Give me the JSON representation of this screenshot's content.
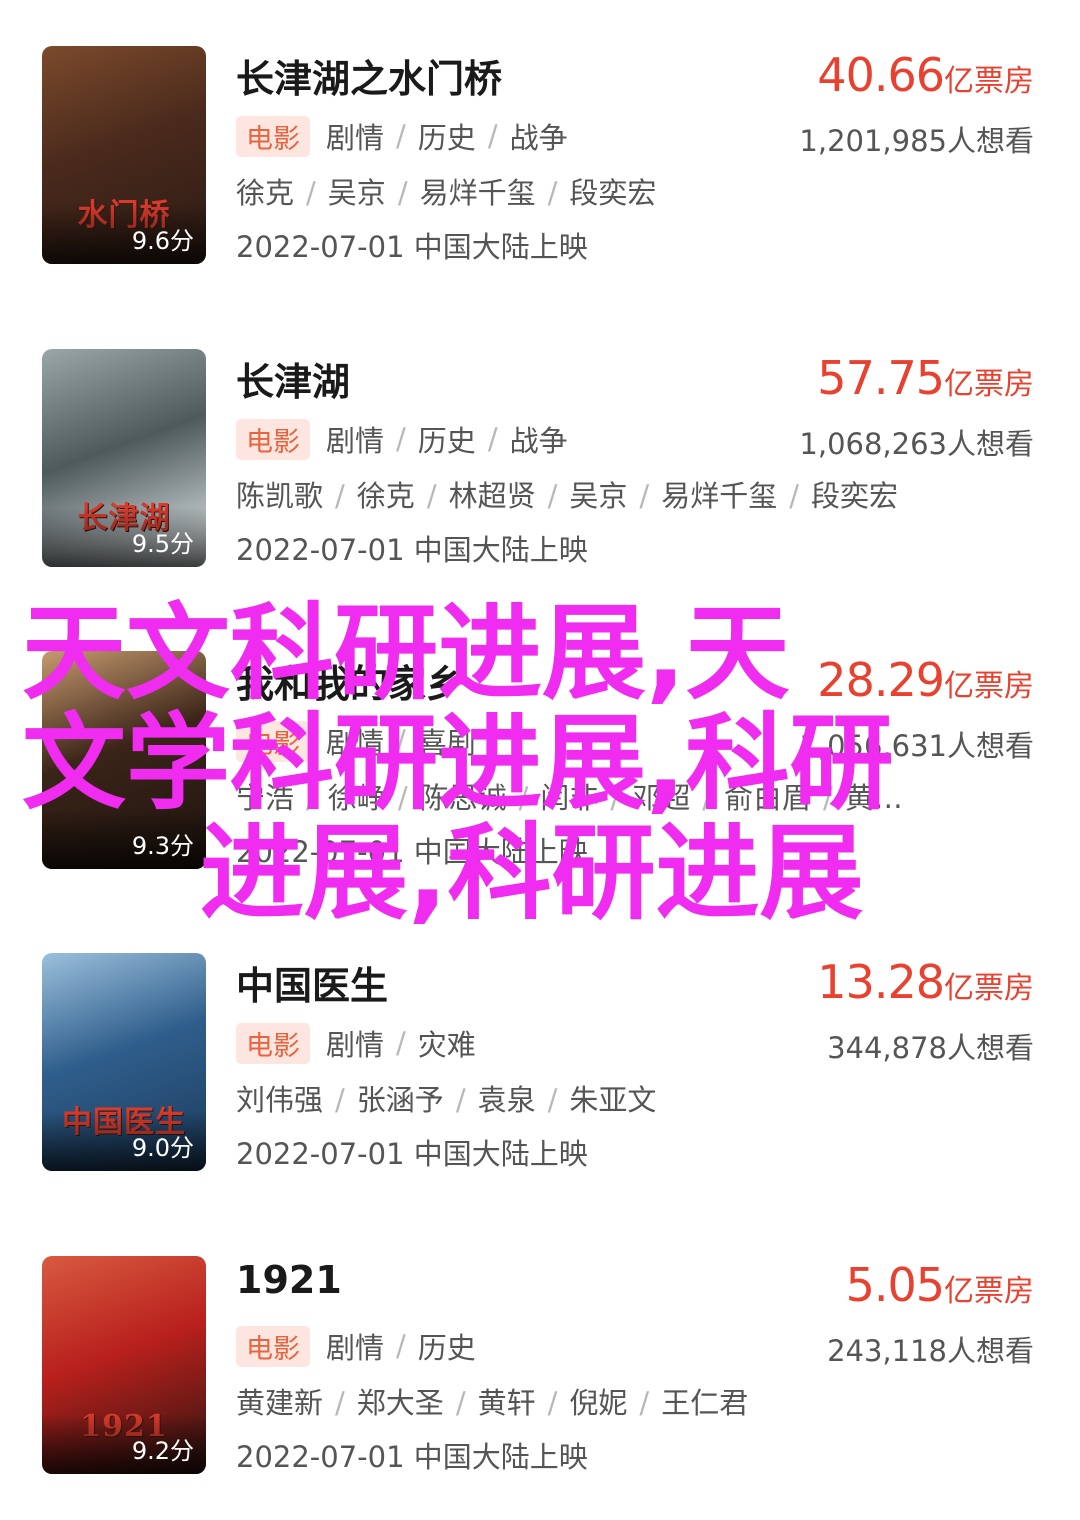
{
  "movies": [
    {
      "title": "长津湖之水门桥",
      "box_office": "40.66",
      "box_office_unit": "亿票房",
      "tag": "电影",
      "genres": [
        "剧情",
        "历史",
        "战争"
      ],
      "want": "1,201,985人想看",
      "cast": [
        "徐克",
        "吴京",
        "易烊千玺",
        "段奕宏"
      ],
      "release": "2022-07-01 中国大陆上映",
      "score": "9.6分",
      "poster_text": "水门桥",
      "poster_colors": [
        "#4a2a1c",
        "#7c4a2c",
        "#2b1a14"
      ]
    },
    {
      "title": "长津湖",
      "box_office": "57.75",
      "box_office_unit": "亿票房",
      "tag": "电影",
      "genres": [
        "剧情",
        "历史",
        "战争"
      ],
      "want": "1,068,263人想看",
      "cast": [
        "陈凯歌",
        "徐克",
        "林超贤",
        "吴京",
        "易烊千玺",
        "段奕宏"
      ],
      "release": "2022-07-01 中国大陆上映",
      "score": "9.5分",
      "poster_text": "长津湖",
      "poster_colors": [
        "#4e5a5c",
        "#9aa6a8",
        "#e8eef0"
      ]
    },
    {
      "title": "我和我的家乡",
      "box_office": "28.29",
      "box_office_unit": "亿票房",
      "tag": "电影",
      "genres": [
        "剧情",
        "喜剧"
      ],
      "want": "1,056,631人想看",
      "cast": [
        "宁浩",
        "徐峥",
        "陈思诚",
        "闫非",
        "邓超",
        "俞白眉",
        "黄…"
      ],
      "release": "2022-07-01 中国大陆上映",
      "score": "9.3分",
      "poster_text": "",
      "poster_colors": [
        "#3a2418",
        "#c69a6e",
        "#1e140e"
      ]
    },
    {
      "title": "中国医生",
      "box_office": "13.28",
      "box_office_unit": "亿票房",
      "tag": "电影",
      "genres": [
        "剧情",
        "灾难"
      ],
      "want": "344,878人想看",
      "cast": [
        "刘伟强",
        "张涵予",
        "袁泉",
        "朱亚文"
      ],
      "release": "2022-07-01 中国大陆上映",
      "score": "9.0分",
      "poster_text": "中国医生",
      "poster_colors": [
        "#2f5e8c",
        "#9cc0dc",
        "#1c3a5a"
      ]
    },
    {
      "title": "1921",
      "box_office": "5.05",
      "box_office_unit": "亿票房",
      "tag": "电影",
      "genres": [
        "剧情",
        "历史"
      ],
      "want": "243,118人想看",
      "cast": [
        "黄建新",
        "郑大圣",
        "黄轩",
        "倪妮",
        "王仁君"
      ],
      "release": "2022-07-01 中国大陆上映",
      "score": "9.2分",
      "poster_text": "1921",
      "poster_colors": [
        "#b8201c",
        "#d85a40",
        "#2a1410"
      ]
    }
  ],
  "overlay_text": "天文科研进展,天文学科研进展,科研进展,科研进展"
}
